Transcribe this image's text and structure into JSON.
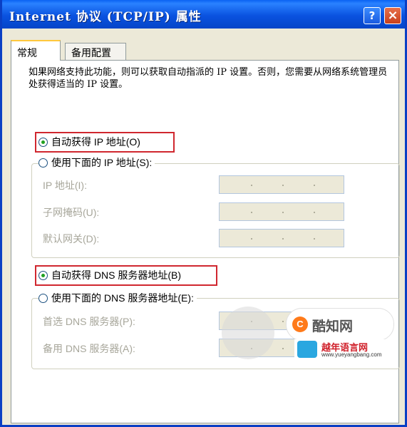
{
  "window": {
    "title": "Internet 协议 (TCP/IP) 属性",
    "help_label": "?",
    "close_label": "×"
  },
  "tabs": [
    {
      "label": "常规",
      "active": true
    },
    {
      "label": "备用配置",
      "active": false
    }
  ],
  "description": "如果网络支持此功能，则可以获取自动指派的 IP 设置。否则，您需要从网络系统管理员处获得适当的 IP 设置。",
  "ip_section": {
    "auto_option": {
      "label": "自动获得 IP 地址(O)",
      "checked": true
    },
    "manual_option": {
      "label": "使用下面的 IP 地址(S):",
      "checked": false
    },
    "fields": [
      {
        "label": "IP 地址(I):",
        "value": ". . ."
      },
      {
        "label": "子网掩码(U):",
        "value": ". . ."
      },
      {
        "label": "默认网关(D):",
        "value": ". . ."
      }
    ]
  },
  "dns_section": {
    "auto_option": {
      "label": "自动获得 DNS 服务器地址(B)",
      "checked": true
    },
    "manual_option": {
      "label": "使用下面的 DNS 服务器地址(E):",
      "checked": false
    },
    "fields": [
      {
        "label": "首选 DNS 服务器(P):",
        "value": ". . ."
      },
      {
        "label": "备用 DNS 服务器(A):",
        "value": ". . ."
      }
    ]
  },
  "watermark": {
    "logo_text": "酷知网",
    "badge_name": "越年语言网",
    "badge_url": "www.yueyangbang.com"
  },
  "colors": {
    "titlebar": "#0a52e0",
    "highlight": "#d0272f",
    "radio_dot": "#21a121",
    "disabled_text": "#a7a69a",
    "field_bg": "#ece9d8"
  }
}
